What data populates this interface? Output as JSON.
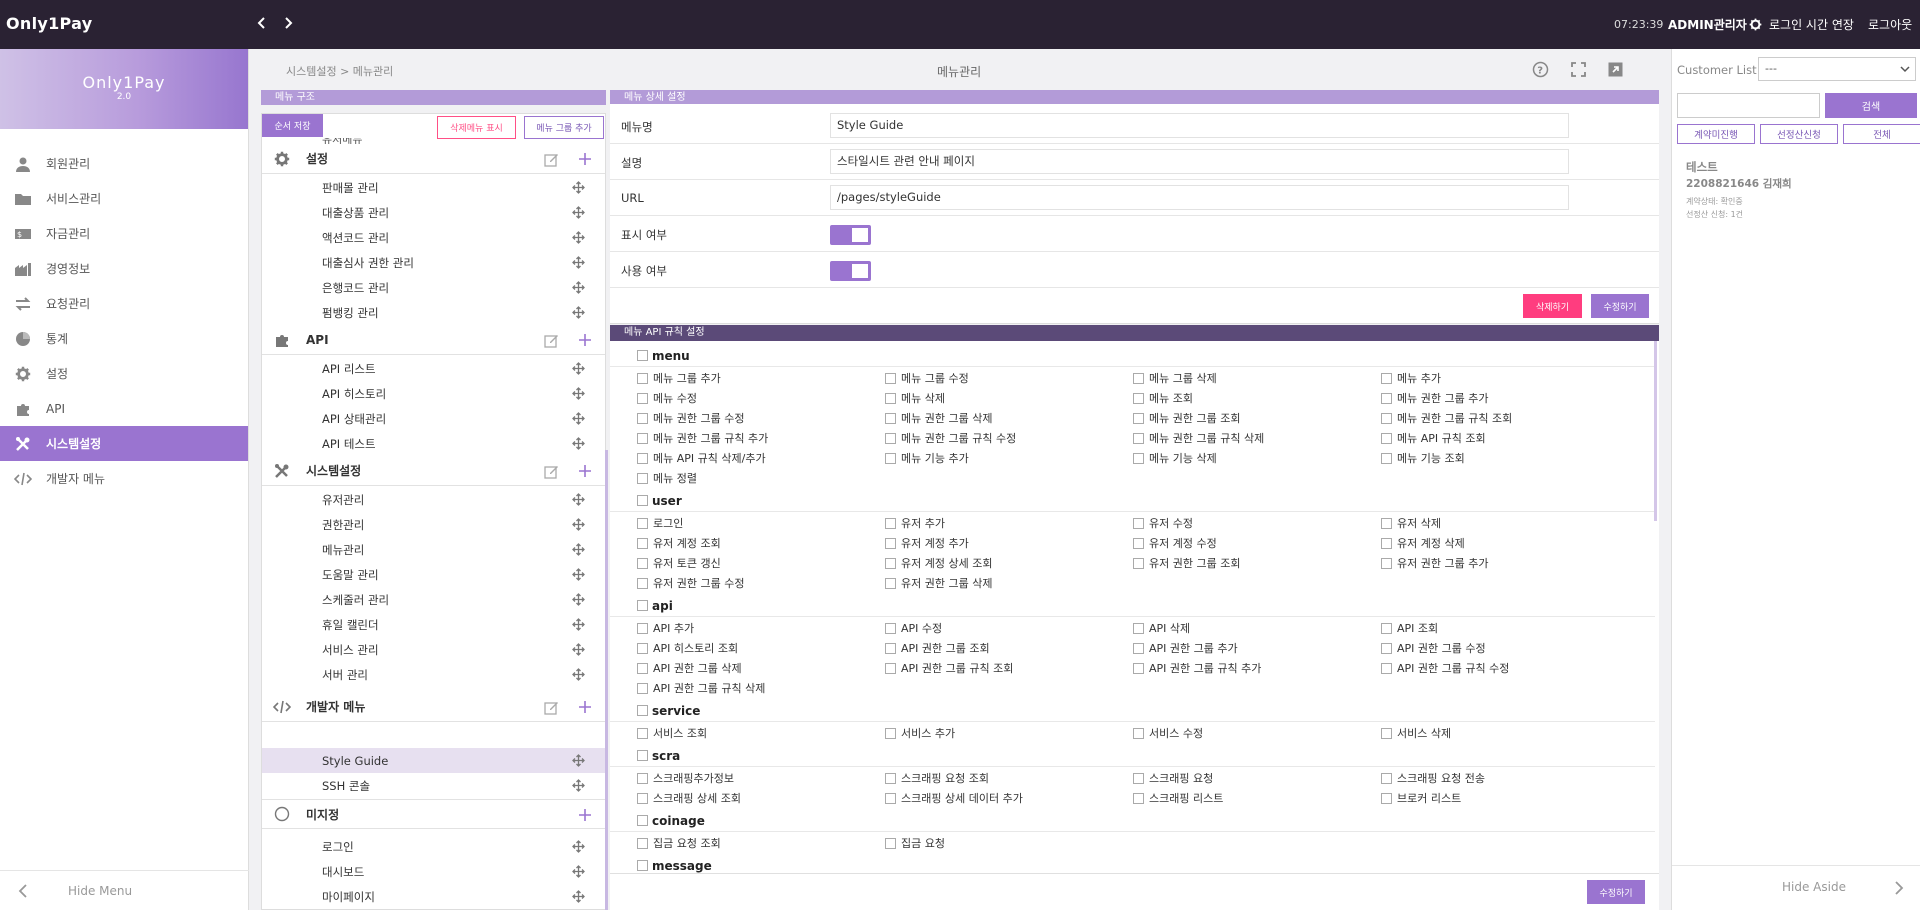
{
  "topbar": {
    "logo": "Only1Pay",
    "clock": "07:23:39",
    "admin": "ADMIN관리자",
    "extend": "로그인 시간 연장",
    "logout": "로그아웃"
  },
  "sidebar": {
    "brand": "Only1Pay",
    "version": "2.0",
    "items": [
      {
        "label": "회원관리",
        "icon": "user-icon"
      },
      {
        "label": "서비스관리",
        "icon": "folder-icon"
      },
      {
        "label": "자금관리",
        "icon": "money-icon"
      },
      {
        "label": "경영정보",
        "icon": "building-icon"
      },
      {
        "label": "요청관리",
        "icon": "exchange-icon"
      },
      {
        "label": "통계",
        "icon": "pie-chart-icon"
      },
      {
        "label": "설정",
        "icon": "gear-icon"
      },
      {
        "label": "API",
        "icon": "puzzle-icon"
      },
      {
        "label": "시스템설정",
        "icon": "tools-icon"
      },
      {
        "label": "개발자 메뉴",
        "icon": "code-icon"
      }
    ],
    "hide": "Hide Menu"
  },
  "header": {
    "breadcrumb": "시스템설정 > 메뉴관리",
    "title": "메뉴관리"
  },
  "tree": {
    "header": "메뉴 구조",
    "save": "순서 저장",
    "show_deleted": "삭제메뉴 표시",
    "add_group": "메뉴 그룹 추가",
    "cut_label": "유저메뉴",
    "groups": [
      {
        "label": "설정",
        "items": [
          "판매몰 관리",
          "대출상품 관리",
          "액션코드 관리",
          "대출심사 권한 관리",
          "은행코드 관리",
          "펌뱅킹 관리"
        ]
      },
      {
        "label": "API",
        "items": [
          "API 리스트",
          "API 히스토리",
          "API 상태관리",
          "API 테스트"
        ]
      },
      {
        "label": "시스템설정",
        "items": [
          "유저관리",
          "권한관리",
          "메뉴관리",
          "도움말 관리",
          "스케줄러 관리",
          "휴일 캘린더",
          "서비스 관리",
          "서버 관리"
        ]
      },
      {
        "label": "개발자 메뉴",
        "items": [
          "Style Guide",
          "SSH 콘솔"
        ]
      },
      {
        "label": "미지정",
        "items": [
          "로그인",
          "대시보드",
          "마이페이지"
        ]
      }
    ]
  },
  "detail": {
    "header": "메뉴 상세 설정",
    "name_label": "메뉴명",
    "name_value": "Style Guide",
    "desc_label": "설명",
    "desc_value": "스타일시트 관련 안내 페이지",
    "url_label": "URL",
    "url_value": "/pages/styleGuide",
    "display_label": "표시 여부",
    "display_on": true,
    "use_label": "사용 여부",
    "use_on": true,
    "delete": "삭제하기",
    "update": "수정하기"
  },
  "api": {
    "header": "메뉴 API 규칙 설정",
    "update": "수정하기",
    "sections": [
      {
        "name": "menu",
        "items": [
          "메뉴 그룹 추가",
          "메뉴 그룹 수정",
          "메뉴 그룹 삭제",
          "메뉴 추가",
          "메뉴 수정",
          "메뉴 삭제",
          "메뉴 조회",
          "메뉴 권한 그룹 추가",
          "메뉴 권한 그룹 수정",
          "메뉴 권한 그룹 삭제",
          "메뉴 권한 그룹 조회",
          "메뉴 권한 그룹 규칙 조회",
          "메뉴 권한 그룹 규칙 추가",
          "메뉴 권한 그룹 규칙 수정",
          "메뉴 권한 그룹 규칙 삭제",
          "메뉴 API 규칙 조회",
          "메뉴 API 규칙 삭제/추가",
          "메뉴 기능 추가",
          "메뉴 기능 삭제",
          "메뉴 기능 조회",
          "메뉴 정렬"
        ]
      },
      {
        "name": "user",
        "items": [
          "로그인",
          "유저 추가",
          "유저 수정",
          "유저 삭제",
          "유저 계정 조회",
          "유저 계정 추가",
          "유저 계정 수정",
          "유저 계정 삭제",
          "유저 토큰 갱신",
          "유저 계정 상세 조회",
          "유저 권한 그룹 조회",
          "유저 권한 그룹 추가",
          "유저 권한 그룹 수정",
          "유저 권한 그룹 삭제"
        ]
      },
      {
        "name": "api",
        "items": [
          "API 추가",
          "API 수정",
          "API 삭제",
          "API 조회",
          "API 히스토리 조회",
          "API 권한 그룹 조회",
          "API 권한 그룹 추가",
          "API 권한 그룹 수정",
          "API 권한 그룹 삭제",
          "API 권한 그룹 규칙 조회",
          "API 권한 그룹 규칙 추가",
          "API 권한 그룹 규칙 수정",
          "API 권한 그룹 규칙 삭제"
        ]
      },
      {
        "name": "service",
        "items": [
          "서비스 조회",
          "서비스 추가",
          "서비스 수정",
          "서비스 삭제"
        ]
      },
      {
        "name": "scra",
        "items": [
          "스크래핑추가정보",
          "스크래핑 요청 조회",
          "스크래핑 요청",
          "스크래핑 요청 전송",
          "스크래핑 상세 조회",
          "스크래핑 상세 데이터 추가",
          "스크래핑 리스트",
          "브로커 리스트"
        ]
      },
      {
        "name": "coinage",
        "items": [
          "집금 요청 조회",
          "집금 요청"
        ]
      },
      {
        "name": "message",
        "items": []
      }
    ]
  },
  "aside": {
    "customer_label": "Customer List",
    "select_value": "---",
    "search_placeholder": "",
    "search": "검색",
    "filters": [
      "계약미진행",
      "선정산신청",
      "전체"
    ],
    "customer": {
      "name": "테스트",
      "id_line": "2208821646 김재희",
      "status": "계약상태: 확인중",
      "count": "선정산 신청: 1건"
    },
    "hide": "Hide Aside"
  },
  "colors": {
    "accent": "#9a74d0",
    "topbar": "#2a2233",
    "danger": "#ff3d7f"
  }
}
